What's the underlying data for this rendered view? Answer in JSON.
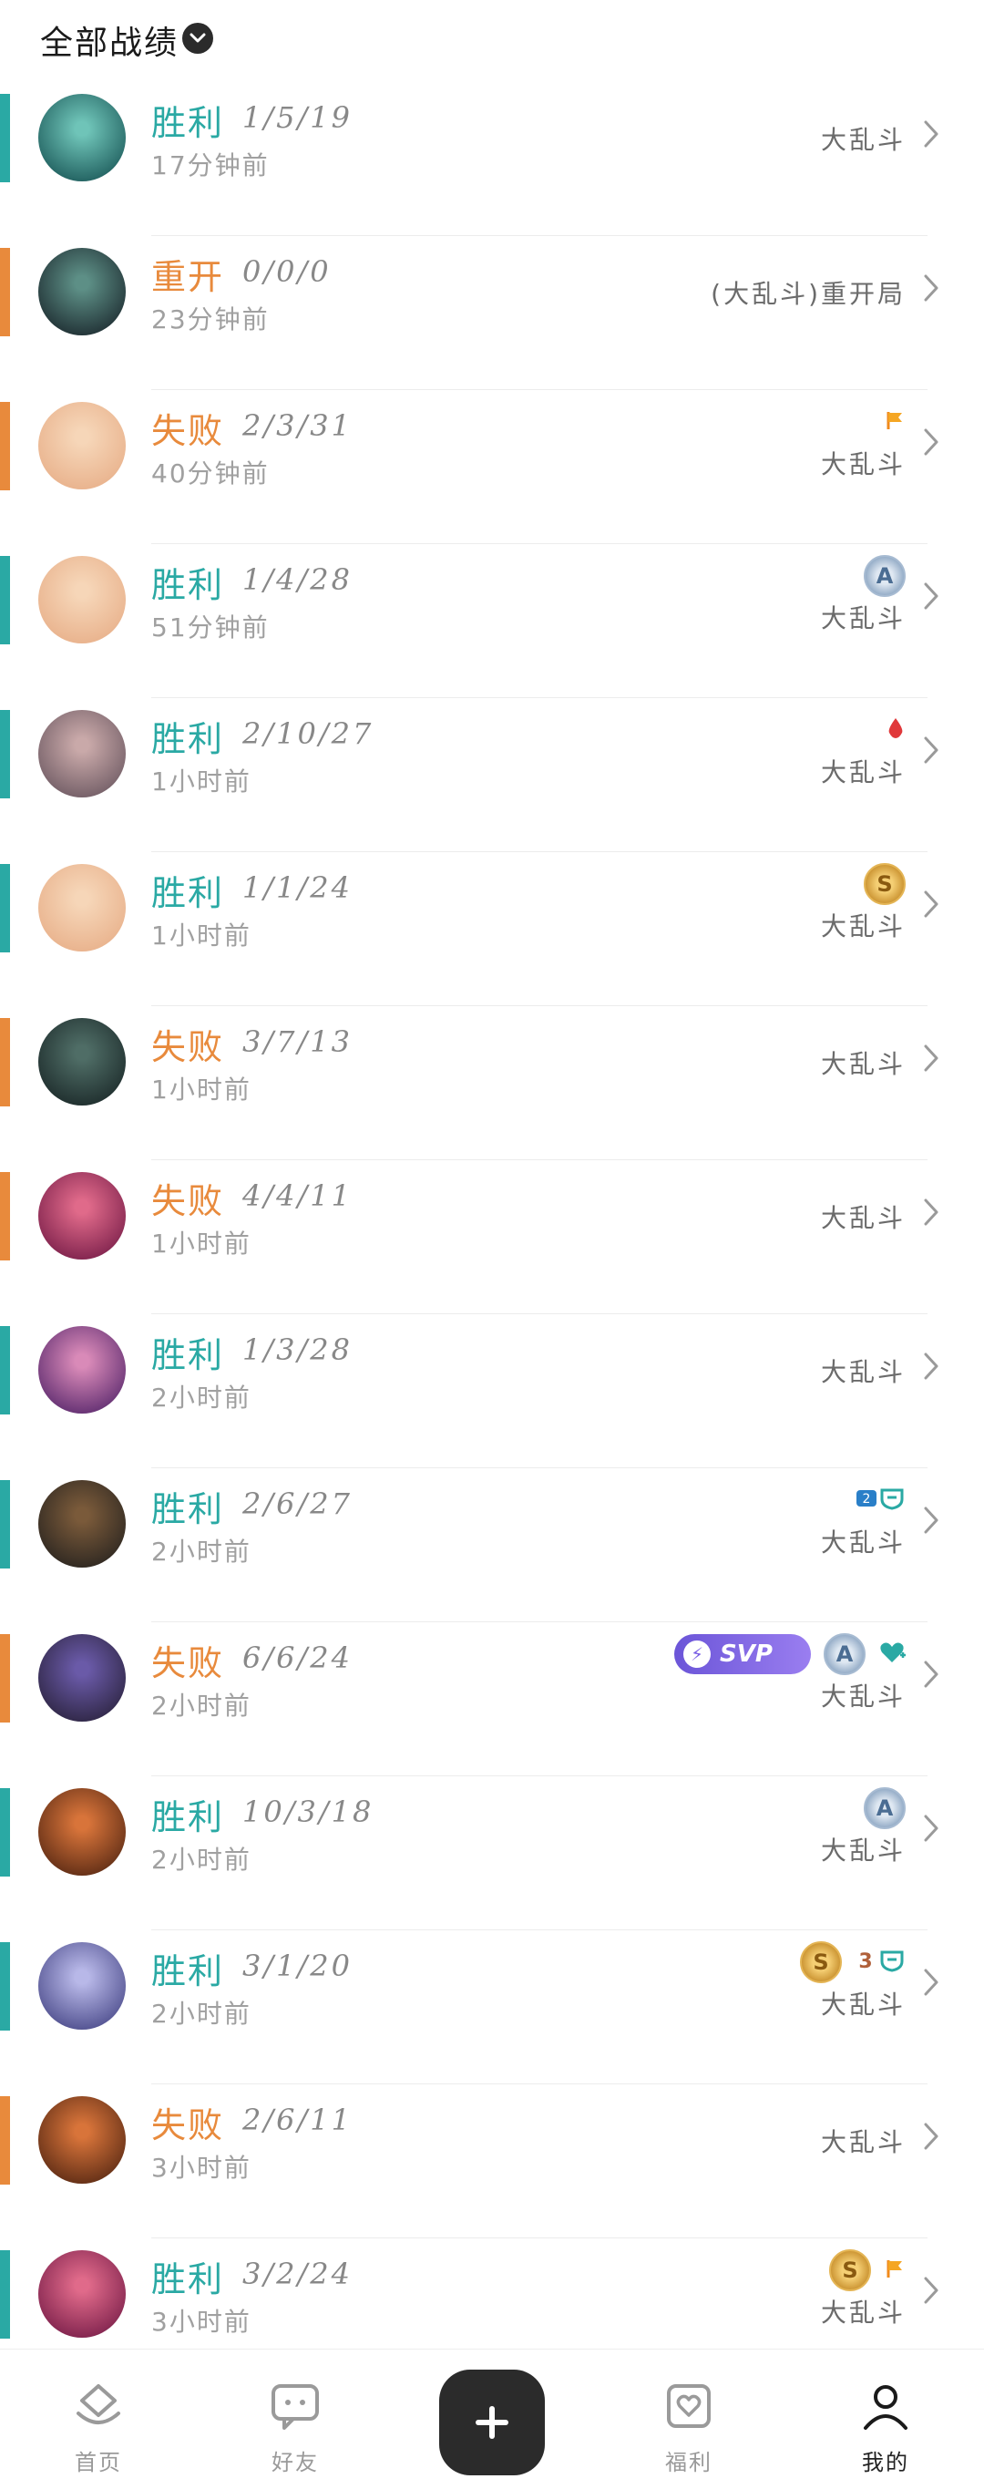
{
  "header": {
    "title": "全部战绩"
  },
  "colors": {
    "win": "#2aa9a4",
    "lose": "#e88a3c"
  },
  "matches": [
    {
      "result": "胜利",
      "outcome": "win",
      "kda": "1/5/19",
      "time": "17分钟前",
      "mode": "大乱斗",
      "avatar": [
        "#1c5a5a",
        "#6fc4b8"
      ],
      "badges": []
    },
    {
      "result": "重开",
      "outcome": "lose",
      "kda": "0/0/0",
      "time": "23分钟前",
      "mode": "(大乱斗)重开局",
      "avatar": [
        "#1d2b30",
        "#5d8f86"
      ],
      "badges": []
    },
    {
      "result": "失败",
      "outcome": "lose",
      "kda": "2/3/31",
      "time": "40分钟前",
      "mode": "大乱斗",
      "avatar": [
        "#e8b08a",
        "#f6d6b8"
      ],
      "badges": [
        "flag"
      ]
    },
    {
      "result": "胜利",
      "outcome": "win",
      "kda": "1/4/28",
      "time": "51分钟前",
      "mode": "大乱斗",
      "avatar": [
        "#e8b08a",
        "#f6d6b8"
      ],
      "badges": [
        "A"
      ]
    },
    {
      "result": "胜利",
      "outcome": "win",
      "kda": "2/10/27",
      "time": "1小时前",
      "mode": "大乱斗",
      "avatar": [
        "#6e5a63",
        "#c9a9a9"
      ],
      "badges": [
        "drop"
      ]
    },
    {
      "result": "胜利",
      "outcome": "win",
      "kda": "1/1/24",
      "time": "1小时前",
      "mode": "大乱斗",
      "avatar": [
        "#e8b08a",
        "#f6d6b8"
      ],
      "badges": [
        "S"
      ]
    },
    {
      "result": "失败",
      "outcome": "lose",
      "kda": "3/7/13",
      "time": "1小时前",
      "mode": "大乱斗",
      "avatar": [
        "#1c2a2a",
        "#4f6d66"
      ],
      "badges": []
    },
    {
      "result": "失败",
      "outcome": "lose",
      "kda": "4/4/11",
      "time": "1小时前",
      "mode": "大乱斗",
      "avatar": [
        "#7a1f4a",
        "#e06a8a"
      ],
      "badges": []
    },
    {
      "result": "胜利",
      "outcome": "win",
      "kda": "1/3/28",
      "time": "2小时前",
      "mode": "大乱斗",
      "avatar": [
        "#5b2a6e",
        "#d98ab8"
      ],
      "badges": []
    },
    {
      "result": "胜利",
      "outcome": "win",
      "kda": "2/6/27",
      "time": "2小时前",
      "mode": "大乱斗",
      "avatar": [
        "#2a2520",
        "#7a5a3a"
      ],
      "badges": [
        "mvp2"
      ]
    },
    {
      "result": "失败",
      "outcome": "lose",
      "kda": "6/6/24",
      "time": "2小时前",
      "mode": "大乱斗",
      "avatar": [
        "#2c2440",
        "#6a5aa8"
      ],
      "badges": [
        "SVP",
        "A",
        "heart"
      ]
    },
    {
      "result": "胜利",
      "outcome": "win",
      "kda": "10/3/18",
      "time": "2小时前",
      "mode": "大乱斗",
      "avatar": [
        "#5a2a14",
        "#d8743a"
      ],
      "badges": [
        "A"
      ]
    },
    {
      "result": "胜利",
      "outcome": "win",
      "kda": "3/1/20",
      "time": "2小时前",
      "mode": "大乱斗",
      "avatar": [
        "#4a4a8a",
        "#b8b8e8"
      ],
      "badges": [
        "S",
        "mvp3"
      ]
    },
    {
      "result": "失败",
      "outcome": "lose",
      "kda": "2/6/11",
      "time": "3小时前",
      "mode": "大乱斗",
      "avatar": [
        "#5a2a14",
        "#d8743a"
      ],
      "badges": []
    },
    {
      "result": "胜利",
      "outcome": "win",
      "kda": "3/2/24",
      "time": "3小时前",
      "mode": "大乱斗",
      "avatar": [
        "#7a1f4a",
        "#e06a8a"
      ],
      "badges": [
        "S",
        "flag"
      ]
    }
  ],
  "svp_label": "SVP",
  "tabbar": {
    "items": [
      {
        "label": "首页",
        "icon": "home-icon"
      },
      {
        "label": "好友",
        "icon": "chat-icon"
      },
      {
        "label": "福利",
        "icon": "gift-icon"
      },
      {
        "label": "我的",
        "icon": "profile-icon"
      }
    ]
  }
}
